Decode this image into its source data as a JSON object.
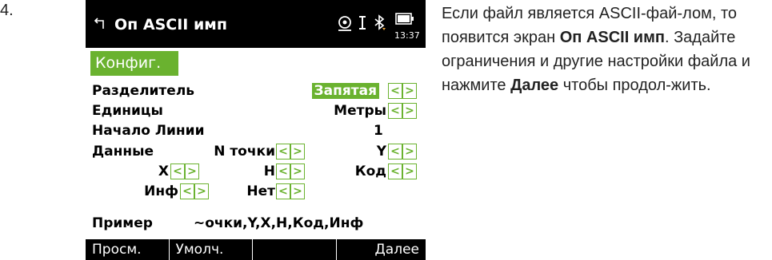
{
  "step_number": "4.",
  "screen": {
    "title": "Оп ASCII имп",
    "clock": "13:37",
    "tab": "Конфиг.",
    "rows": {
      "separator": {
        "label": "Разделитель",
        "value": "Запятая"
      },
      "units": {
        "label": "Единицы",
        "value": "Метры"
      },
      "start_line": {
        "label": "Начало Линии",
        "value": "1"
      },
      "data": {
        "label": "Данные",
        "fields": [
          {
            "label": "N точки"
          },
          {
            "label": "Y"
          },
          {
            "label": "X"
          },
          {
            "label": "H"
          },
          {
            "label": "Код"
          },
          {
            "label": "Инф"
          },
          {
            "label": "Нет"
          }
        ]
      },
      "example": {
        "label": "Пример",
        "value": "~очки,Y,X,H,Код,Инф"
      }
    },
    "softkeys": [
      "Просм.",
      "Умолч.",
      "",
      "Далее"
    ],
    "colors": {
      "accent": "#6ab22f",
      "bar": "#000000"
    },
    "icons": [
      "back-arrow-icon",
      "target-icon",
      "cursor-icon",
      "bluetooth-icon",
      "battery-icon"
    ]
  },
  "description": {
    "part1": "Если файл является ASCII-фай-лом, то появится экран ",
    "bold1": "Оп ASCII имп",
    "part2": ". Задайте ограничения и другие настройки файла и нажмите ",
    "bold2": "Далее",
    "part3": " чтобы продол-жить."
  }
}
